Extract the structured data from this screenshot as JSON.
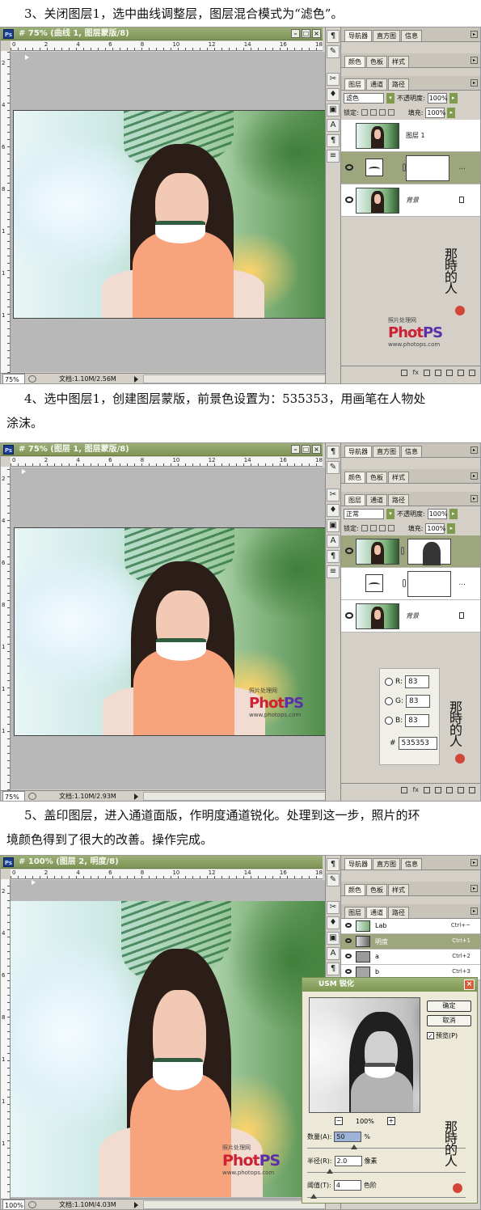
{
  "steps": {
    "step3": "3、关闭图层1，选中曲线调整层，图层混合模式为“滤色”。",
    "step4_line1": "4、选中图层1，创建图层蒙版，前景色设置为：535353，用画笔在人物处",
    "step4_line2": "涂沫。",
    "step5_line1": "5、盖印图层，进入通道面版，作明度通道锐化。处理到这一步，照片的环",
    "step5_line2": "境颜色得到了很大的改善。操作完成。"
  },
  "app": {
    "badge": "Ps"
  },
  "ruler_numbers_h": [
    "0",
    "2",
    "4",
    "6",
    "8",
    "10",
    "12",
    "14",
    "16",
    "18"
  ],
  "ruler_numbers_v": [
    "2",
    "4",
    "6",
    "8",
    "1",
    "1",
    "1"
  ],
  "window1": {
    "doc_title": "# 75% (曲线 1, 图层蒙版/8)",
    "zoom": "75%",
    "doc_info": "文档:1.10M/2.56M",
    "panel_tabs_top": [
      "导航器",
      "直方图",
      "信息"
    ],
    "panel_tabs_mid": [
      "颜色",
      "色板",
      "样式"
    ],
    "panel_tabs_layers": [
      "图层",
      "通道",
      "路径"
    ],
    "blend_mode": "滤色",
    "opacity_label": "不透明度:",
    "opacity_value": "100%",
    "lock_label": "锁定:",
    "fill_label": "填充:",
    "fill_value": "100%",
    "layers": [
      {
        "name": "图层 1"
      },
      {
        "name": ""
      },
      {
        "name": "背景"
      }
    ],
    "logo_sub": "照片处理网",
    "logo_main_a": "Phot",
    "logo_main_b": "PS",
    "logo_url": "www.photops.com"
  },
  "window2": {
    "doc_title": "# 75% (图层 1, 图层蒙版/8)",
    "zoom": "75%",
    "doc_info": "文档:1.10M/2.93M",
    "panel_tabs_top": [
      "导航器",
      "直方图",
      "信息"
    ],
    "panel_tabs_mid": [
      "颜色",
      "色板",
      "样式"
    ],
    "panel_tabs_layers": [
      "图层",
      "通道",
      "路径"
    ],
    "blend_mode": "正常",
    "opacity_label": "不透明度:",
    "opacity_value": "100%",
    "lock_label": "锁定:",
    "fill_label": "填充:",
    "fill_value": "100%",
    "layers": [
      {
        "name": ""
      },
      {
        "name": ""
      },
      {
        "name": "背景"
      }
    ],
    "color": {
      "r_label": "R:",
      "r": "83",
      "g_label": "G:",
      "g": "83",
      "b_label": "B:",
      "b": "83",
      "hex_label": "#",
      "hex": "535353"
    },
    "logo_sub": "照片处理网",
    "logo_main_a": "Phot",
    "logo_main_b": "PS",
    "logo_url": "www.photops.com"
  },
  "window3": {
    "doc_title": "# 100% (图层 2, 明度/8)",
    "zoom": "100%",
    "doc_info": "文档:1.10M/4.03M",
    "panel_tabs_top": [
      "导航器",
      "直方图",
      "信息"
    ],
    "panel_tabs_mid": [
      "颜色",
      "色板",
      "样式"
    ],
    "panel_tabs_channels": [
      "图层",
      "通道",
      "路径"
    ],
    "channels": [
      {
        "name": "Lab",
        "key": "Ctrl+~"
      },
      {
        "name": "明度",
        "key": "Ctrl+1"
      },
      {
        "name": "a",
        "key": "Ctrl+2"
      },
      {
        "name": "b",
        "key": "Ctrl+3"
      }
    ],
    "logo_sub": "照片处理网",
    "logo_main_a": "Phot",
    "logo_main_b": "PS",
    "logo_url": "www.photops.com",
    "dialog": {
      "title": "USM 锐化",
      "ok": "确定",
      "cancel": "取消",
      "preview_label": "预览(P)",
      "zoom": "100%",
      "amount_label": "数量(A):",
      "amount_value": "50",
      "amount_unit": "%",
      "radius_label": "半径(R):",
      "radius_value": "2.0",
      "radius_unit": "像素",
      "threshold_label": "阈值(T):",
      "threshold_value": "4",
      "threshold_unit": "色阶"
    }
  }
}
